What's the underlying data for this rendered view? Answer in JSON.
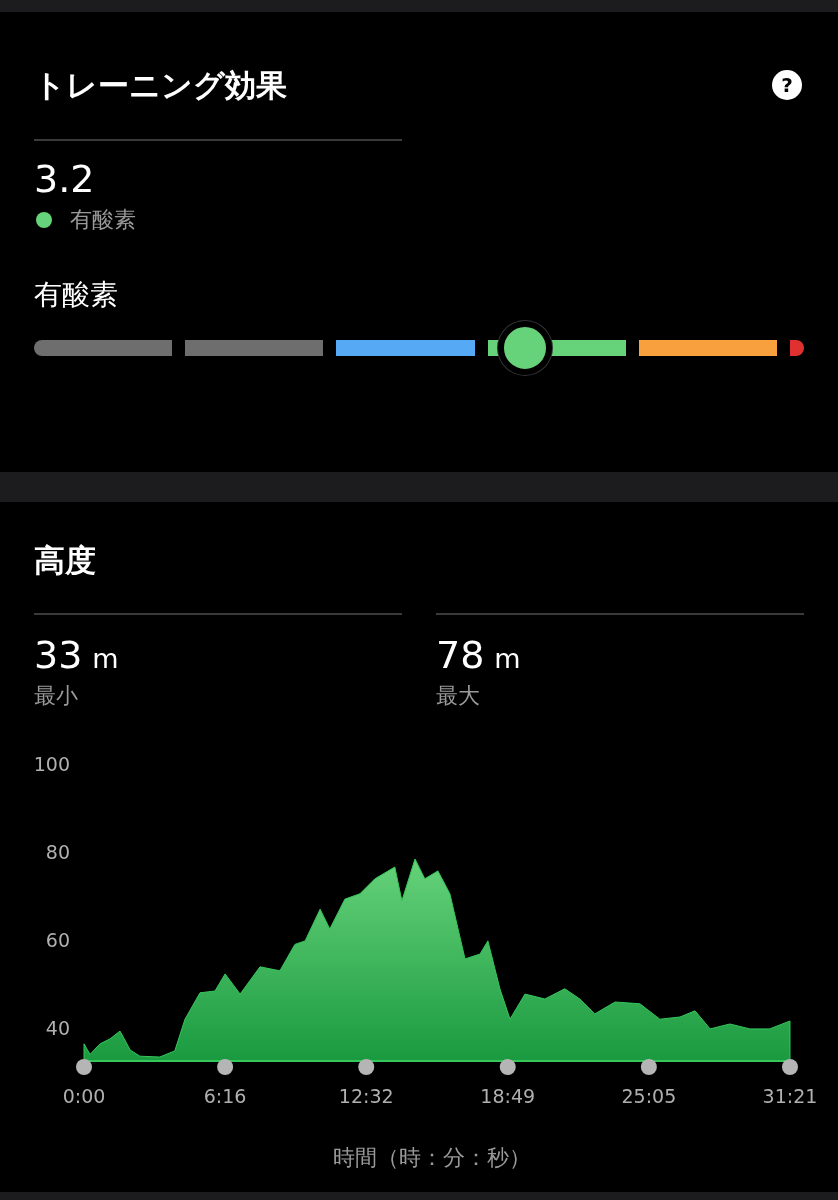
{
  "training": {
    "title": "トレーニング効果",
    "help": "?",
    "value": "3.2",
    "effect": {
      "label": "有酸素",
      "color": "#66d27a"
    },
    "scale_label": "有酸素",
    "scale": {
      "segments": [
        {
          "color": "#6e6e6e"
        },
        {
          "color": "#6e6e6e"
        },
        {
          "color": "#55a9f5"
        },
        {
          "color": "#66d27a"
        },
        {
          "color": "#f8a03d"
        },
        {
          "color": "#e03030"
        }
      ]
    }
  },
  "altitude": {
    "title": "高度",
    "stats": [
      {
        "value": "33",
        "unit": "m",
        "label": "最小"
      },
      {
        "value": "78",
        "unit": "m",
        "label": "最大"
      }
    ],
    "chart_data": {
      "type": "area",
      "xlabel": "時間（時：分：秒）",
      "xlim": [
        0,
        1881
      ],
      "ylim": [
        32.5,
        100
      ],
      "yticks": [
        40,
        60,
        80,
        100
      ],
      "xticks": [
        {
          "value": 0,
          "label": "0:00"
        },
        {
          "value": 376,
          "label": "6:16"
        },
        {
          "value": 752,
          "label": "12:32"
        },
        {
          "value": 1129,
          "label": "18:49"
        },
        {
          "value": 1505,
          "label": "25:05"
        },
        {
          "value": 1881,
          "label": "31:21"
        }
      ],
      "x": [
        0,
        16,
        43,
        69,
        96,
        123,
        149,
        202,
        242,
        269,
        309,
        349,
        376,
        416,
        469,
        522,
        562,
        589,
        629,
        655,
        695,
        735,
        775,
        828,
        847,
        882,
        908,
        943,
        975,
        1015,
        1055,
        1076,
        1108,
        1135,
        1175,
        1228,
        1281,
        1321,
        1361,
        1415,
        1481,
        1534,
        1588,
        1628,
        1668,
        1721,
        1774,
        1827,
        1881
      ],
      "series": [
        {
          "color": "#34c759",
          "values": [
            36.4,
            34,
            36.4,
            37.5,
            39.3,
            35,
            33.6,
            33.4,
            34.8,
            42,
            48,
            48.4,
            52.3,
            47.7,
            53.9,
            53,
            59,
            59.8,
            67,
            62.5,
            69.3,
            70.5,
            73.9,
            76.6,
            68.9,
            78.4,
            73.9,
            75.7,
            70.5,
            55.7,
            56.8,
            59.8,
            48.9,
            42,
            47.7,
            46.6,
            48.9,
            46.6,
            43.2,
            45.9,
            45.5,
            42,
            42.5,
            43.9,
            39.8,
            40.9,
            39.8,
            39.8,
            41.6
          ]
        }
      ]
    }
  }
}
